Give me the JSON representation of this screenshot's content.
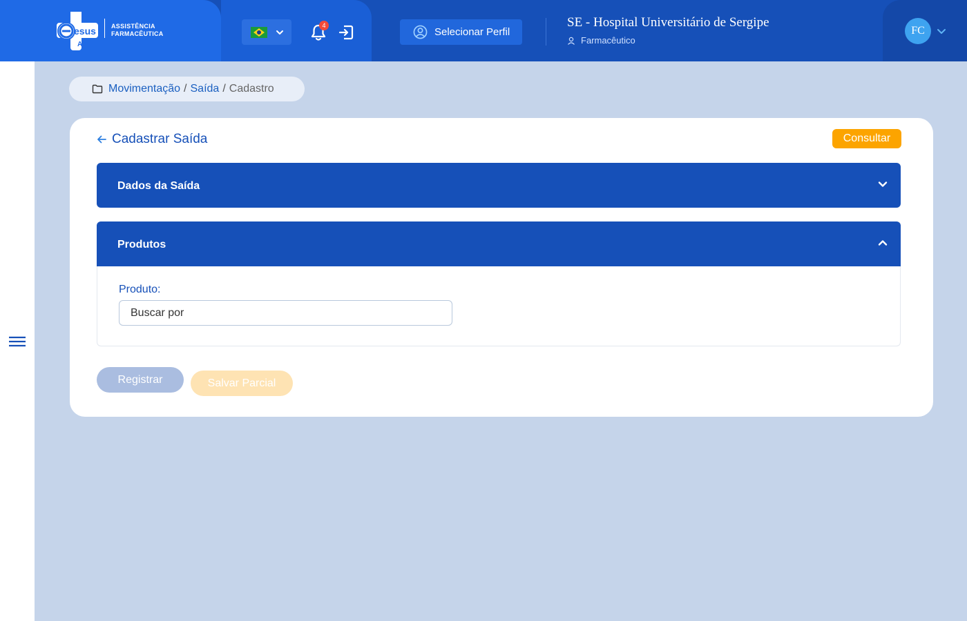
{
  "header": {
    "logo": {
      "brand": "esus",
      "sub": "AF",
      "text_line1": "ASSISTÊNCIA",
      "text_line2": "FARMACÊUTICA"
    },
    "language": {
      "selected": "Brasil",
      "icon": "flag-brazil-icon"
    },
    "notifications": {
      "count": "4",
      "icon": "bell-icon"
    },
    "logout_icon": "logout-icon",
    "profile_button": "Selecionar Perfil",
    "hospital": "SE - Hospital Universitário de Sergipe",
    "role": "Farmacêutico",
    "avatar_initials": "FC"
  },
  "sidebar": {
    "menu_icon": "hamburger-icon"
  },
  "breadcrumb": {
    "items": [
      "Movimentação",
      "Saída"
    ],
    "current": "Cadastro",
    "separator": "/"
  },
  "page": {
    "title": "Cadastrar Saída",
    "consult_button": "Consultar",
    "sections": [
      {
        "label": "Dados da Saída",
        "expanded": false
      },
      {
        "label": "Produtos",
        "expanded": true
      }
    ],
    "product_field": {
      "label": "Produto:",
      "placeholder": "Buscar por",
      "value": ""
    },
    "register_button": "Registrar",
    "save_partial_button": "Salvar Parcial"
  },
  "colors": {
    "primary": "#1650b8",
    "header_light": "#1f6ae6",
    "background": "#c5d4ea",
    "accent_orange": "#fca400",
    "notification_red": "#f24a3a"
  }
}
